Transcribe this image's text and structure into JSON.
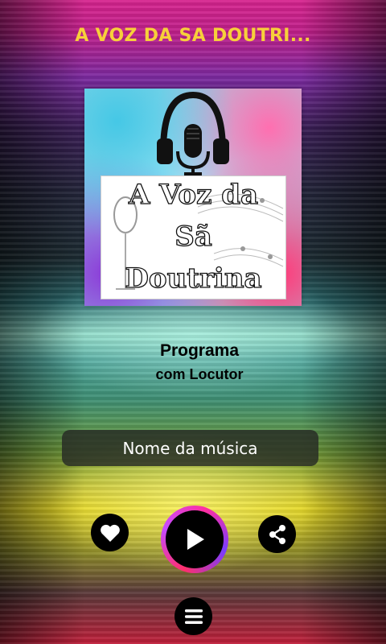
{
  "header": {
    "title": "A VOZ DA SA DOUTRI..."
  },
  "cover": {
    "line1": "A Voz da",
    "line2": "Sã",
    "line3": "Doutrina"
  },
  "program": {
    "name": "Programa",
    "host": "com Locutor"
  },
  "now_playing": {
    "song": "Nome da música"
  },
  "controls": {
    "like_icon": "heart-icon",
    "play_icon": "play-icon",
    "share_icon": "share-icon",
    "menu_icon": "menu-icon"
  },
  "colors": {
    "title": "#f7d03a",
    "button": "#000000",
    "play_ring": "#ff2fa0"
  }
}
